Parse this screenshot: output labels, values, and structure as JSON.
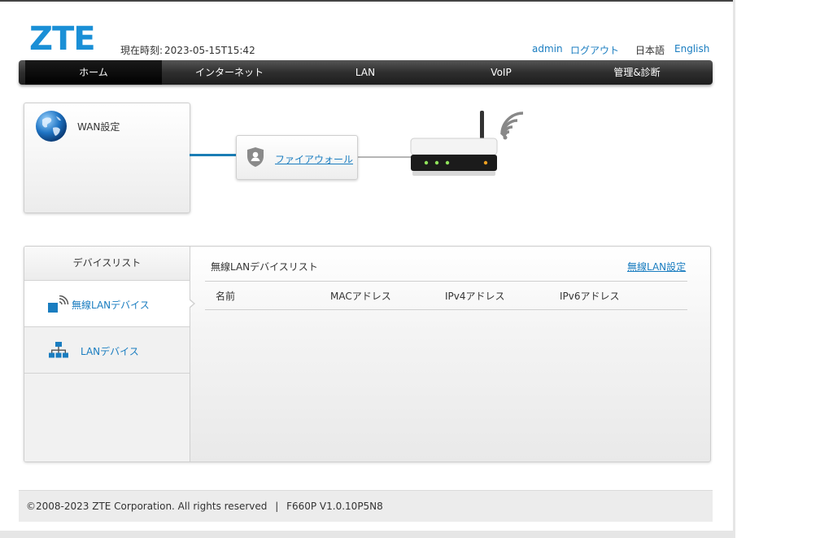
{
  "header": {
    "logo": "ZTE",
    "time_label": "現在時刻:",
    "time_value": "2023-05-15T15:42",
    "user": "admin",
    "logout": "ログアウト",
    "lang_ja": "日本語",
    "lang_en": "English"
  },
  "nav": {
    "items": [
      "ホーム",
      "インターネット",
      "LAN",
      "VoIP",
      "管理&診断"
    ],
    "active": "ホーム"
  },
  "topology": {
    "wan_label": "WAN設定",
    "firewall_link": "ファイアウォール"
  },
  "devices": {
    "side_title": "デバイスリスト",
    "wlan_item": "無線LANデバイス",
    "lan_item": "LANデバイス",
    "list_title": "無線LANデバイスリスト",
    "settings_link": "無線LAN設定",
    "columns": [
      "名前",
      "MACアドレス",
      "IPv4アドレス",
      "IPv6アドレス"
    ],
    "rows": []
  },
  "footer": {
    "copyright": "©2008-2023 ZTE Corporation. All rights reserved",
    "separator": "|",
    "version": "F660P V1.0.10P5N8"
  },
  "colors": {
    "brand_blue": "#1a8fd6",
    "link_blue": "#1a7dc0",
    "nav_dark": "#2e2e2e"
  }
}
